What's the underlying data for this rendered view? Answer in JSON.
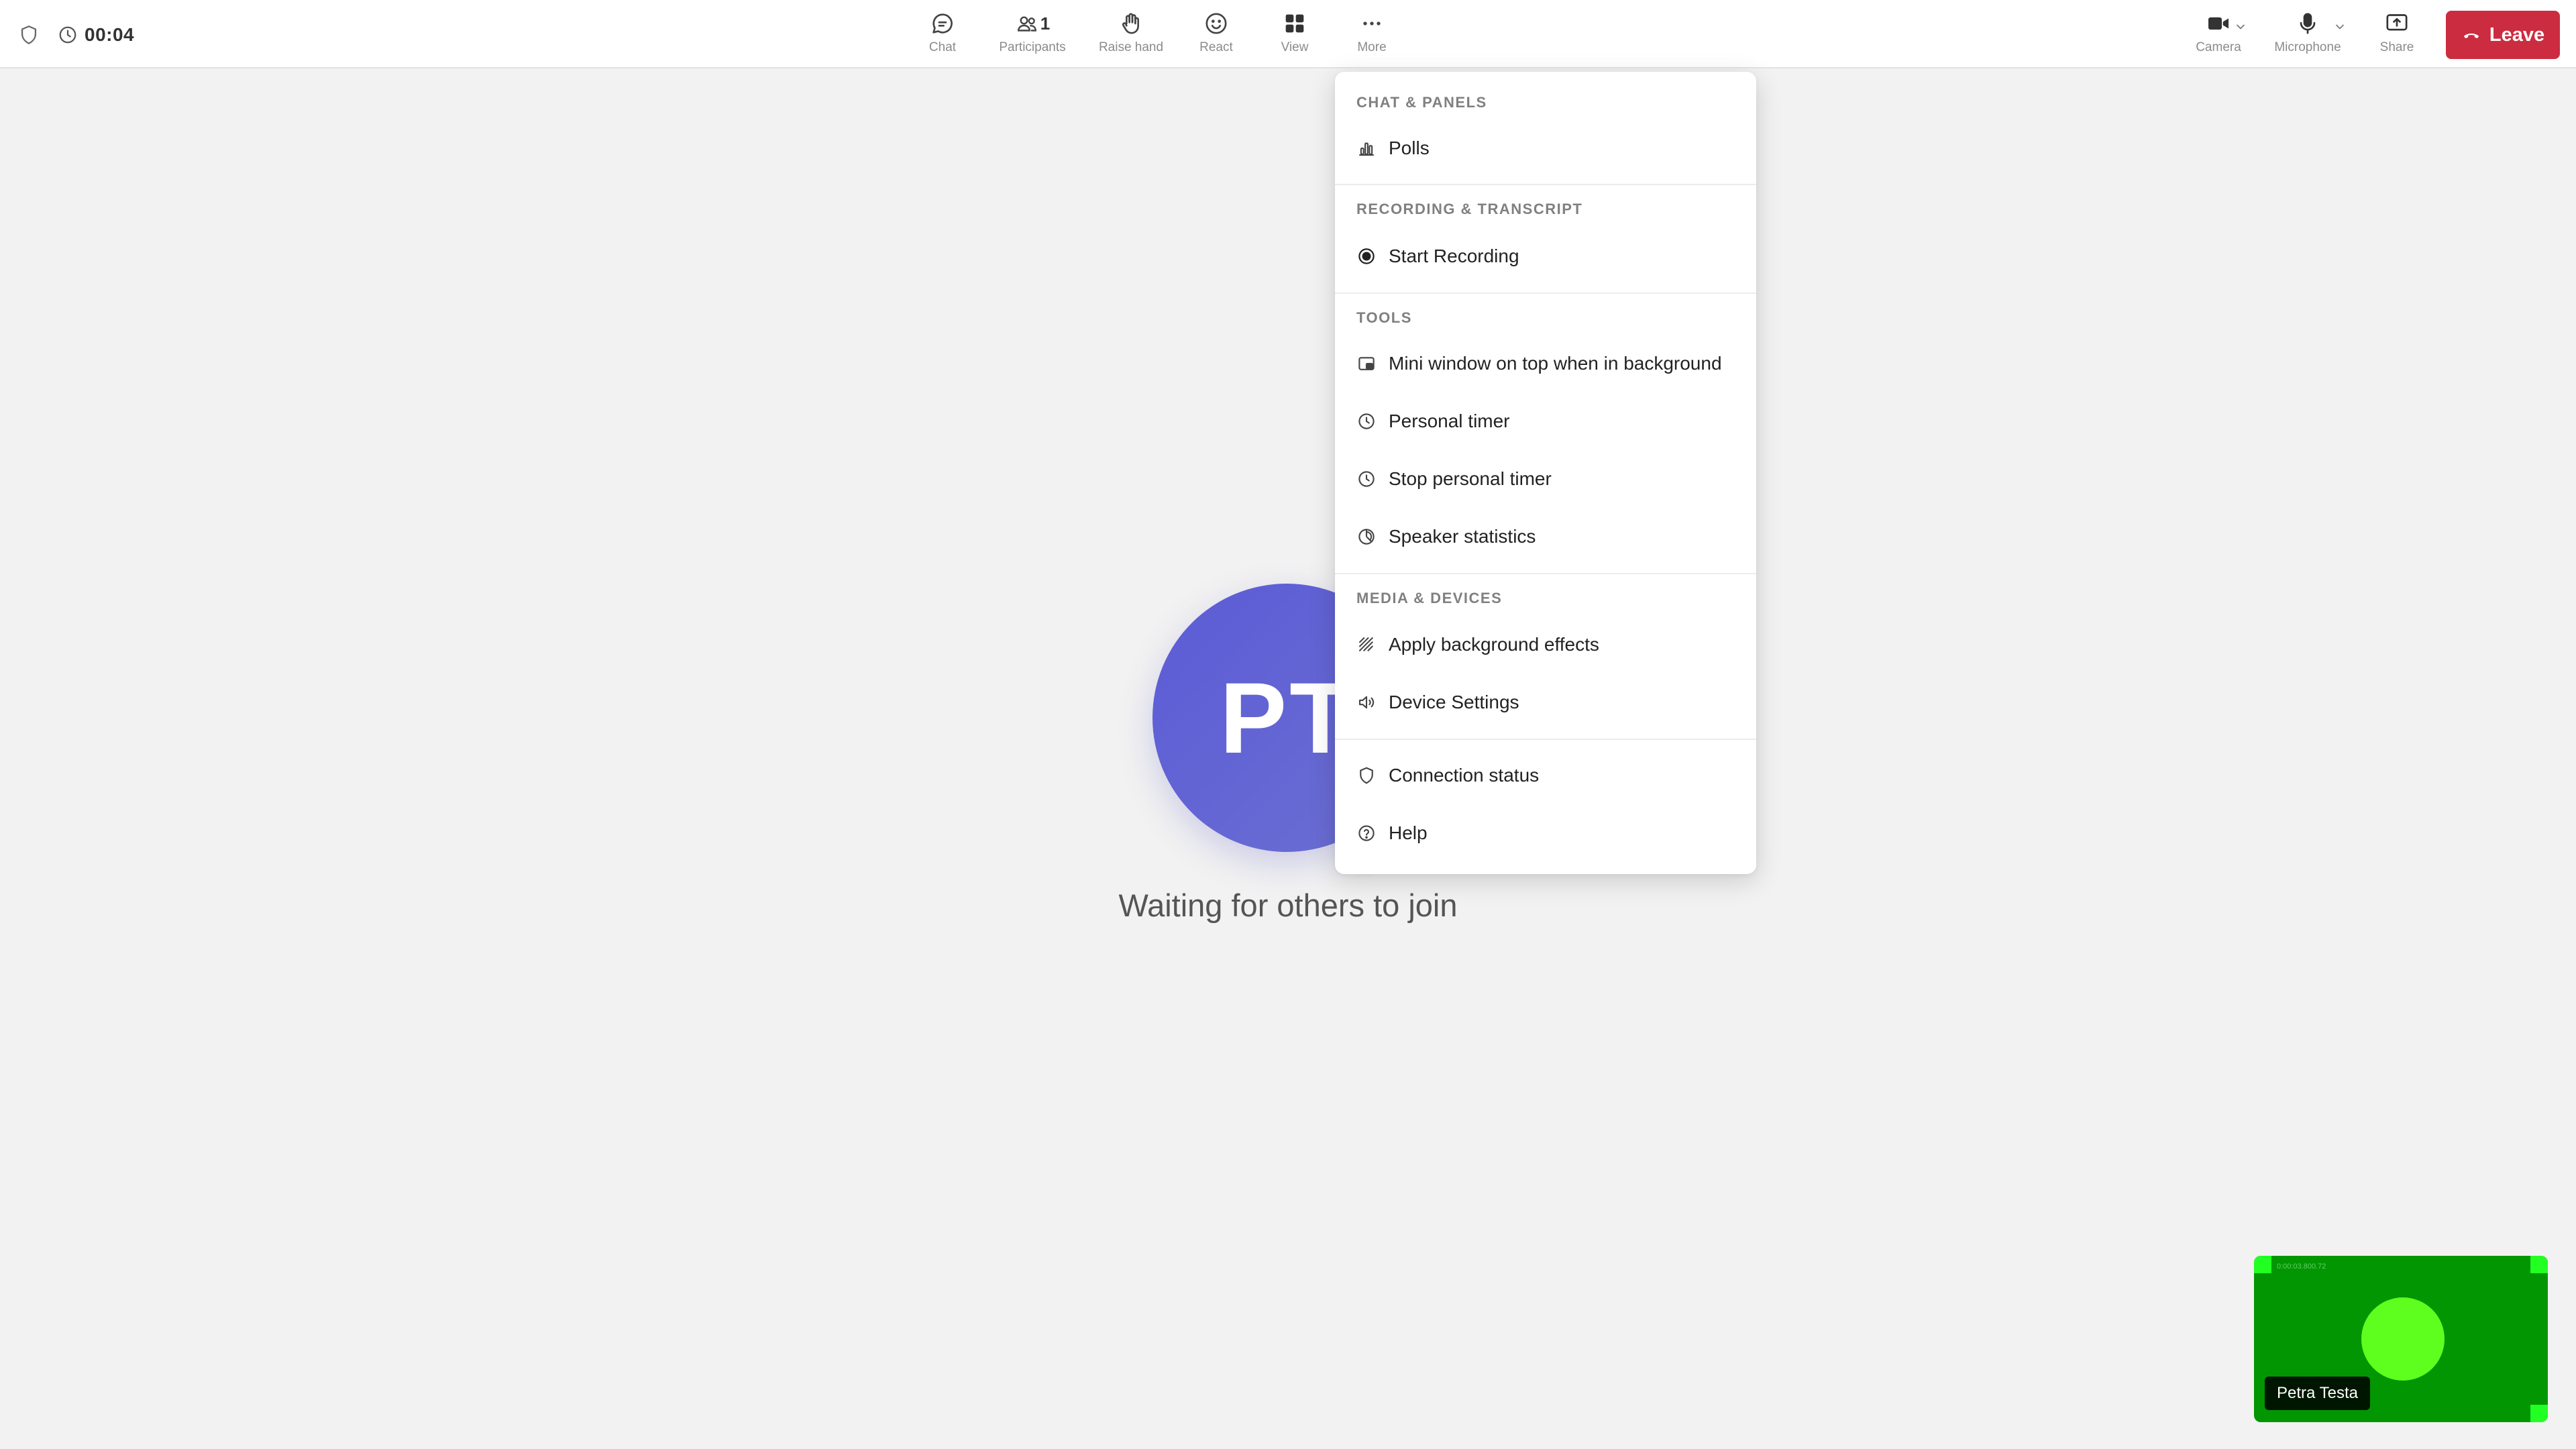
{
  "header": {
    "elapsed_time": "00:04",
    "toolbar": [
      {
        "id": "chat",
        "label": "Chat",
        "icon": "chat-bubble-icon"
      },
      {
        "id": "participants",
        "label": "Participants",
        "icon": "people-icon",
        "count": "1"
      },
      {
        "id": "raise-hand",
        "label": "Raise hand",
        "icon": "hand-icon"
      },
      {
        "id": "react",
        "label": "React",
        "icon": "smiley-icon"
      },
      {
        "id": "view",
        "label": "View",
        "icon": "grid-icon"
      },
      {
        "id": "more",
        "label": "More",
        "icon": "ellipsis-icon"
      }
    ],
    "right_controls": [
      {
        "id": "camera",
        "label": "Camera",
        "icon": "video-camera-icon"
      },
      {
        "id": "microphone",
        "label": "Microphone",
        "icon": "microphone-icon"
      },
      {
        "id": "share",
        "label": "Share",
        "icon": "share-screen-icon"
      }
    ],
    "leave_label": "Leave"
  },
  "main": {
    "avatar_initials": "PT",
    "waiting_text": "Waiting for others to join"
  },
  "more_menu": {
    "sections": [
      {
        "title": "CHAT & PANELS",
        "items": [
          {
            "label": "Polls",
            "icon": "bar-chart-icon"
          }
        ]
      },
      {
        "title": "RECORDING & TRANSCRIPT",
        "items": [
          {
            "label": "Start Recording",
            "icon": "record-icon"
          }
        ]
      },
      {
        "title": "TOOLS",
        "items": [
          {
            "label": "Mini window on top when in background",
            "icon": "mini-window-icon"
          },
          {
            "label": "Personal timer",
            "icon": "clock-icon"
          },
          {
            "label": "Stop personal timer",
            "icon": "clock-icon"
          },
          {
            "label": "Speaker statistics",
            "icon": "pie-chart-icon"
          }
        ]
      },
      {
        "title": "MEDIA & DEVICES",
        "items": [
          {
            "label": "Apply background effects",
            "icon": "background-effects-icon"
          },
          {
            "label": "Device Settings",
            "icon": "speaker-icon"
          }
        ]
      },
      {
        "title": "",
        "items": [
          {
            "label": "Connection status",
            "icon": "shield-icon"
          },
          {
            "label": "Help",
            "icon": "help-icon"
          }
        ]
      }
    ]
  },
  "self_view": {
    "participant_name": "Petra Testa",
    "timestamp_overlay": "0:00:03.800.72"
  },
  "colors": {
    "leave_button": "#cc2c40",
    "avatar": "#5b5bd6",
    "self_view_bg": "#039603"
  }
}
